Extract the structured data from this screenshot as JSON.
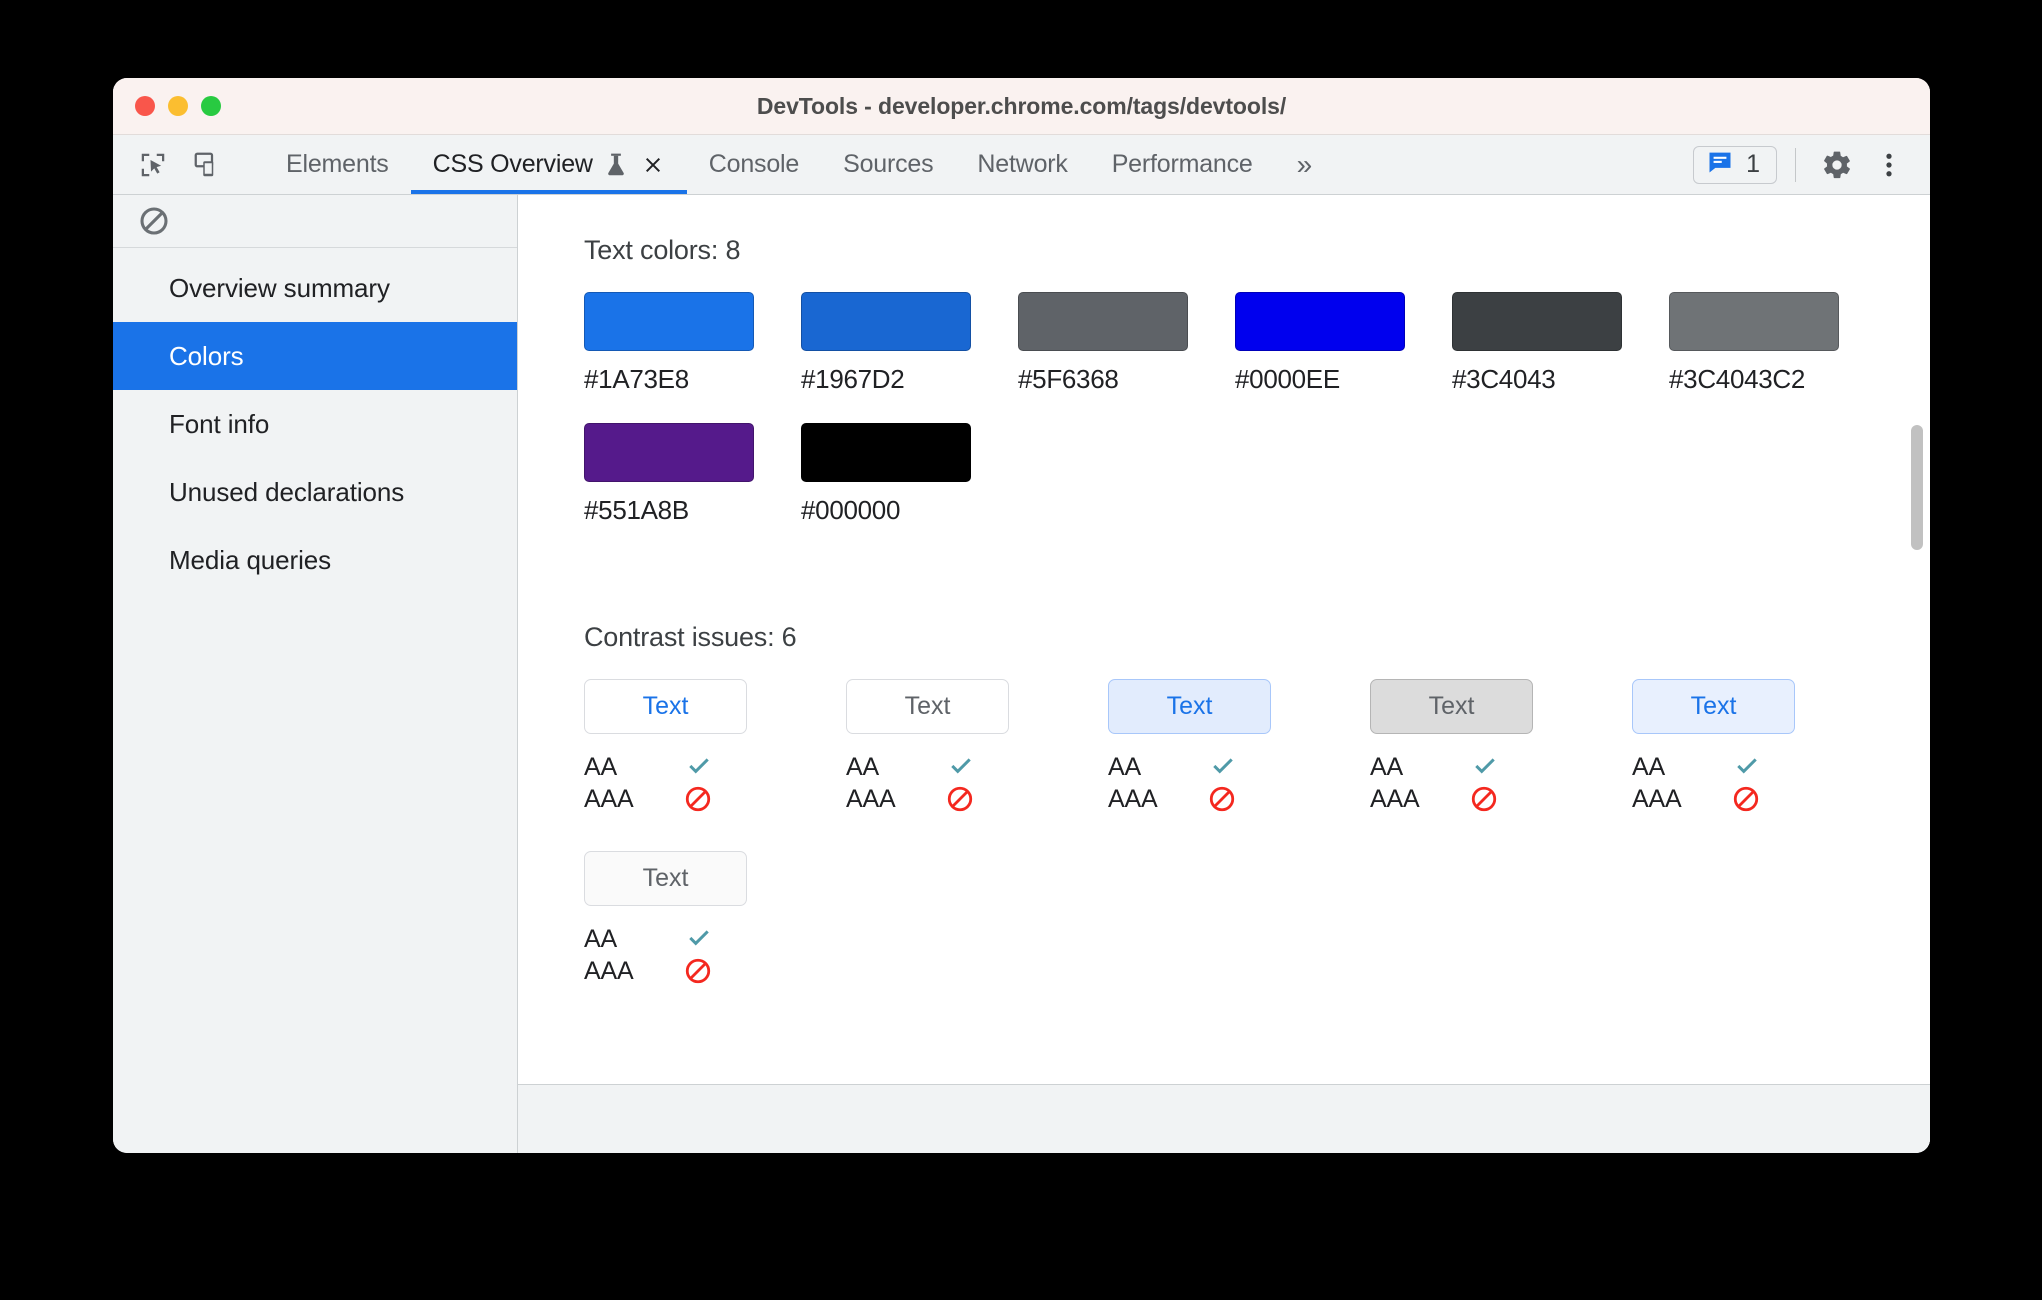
{
  "window": {
    "title": "DevTools - developer.chrome.com/tags/devtools/",
    "traffic_lights": [
      "close-red",
      "minimize-yellow",
      "zoom-green"
    ]
  },
  "toolbar": {
    "inspect_icon": "inspect-cursor-icon",
    "device_icon": "device-toolbar-icon",
    "more_tabs_label": "»",
    "issues": {
      "icon": "issues-message-icon",
      "count": "1"
    },
    "settings_icon": "gear-icon",
    "menu_icon": "vertical-dots-icon"
  },
  "tabs": [
    {
      "label": "Elements",
      "active": false
    },
    {
      "label": "CSS Overview",
      "active": true,
      "experiment_icon": "flask-icon",
      "close_icon": "close-icon"
    },
    {
      "label": "Console",
      "active": false
    },
    {
      "label": "Sources",
      "active": false
    },
    {
      "label": "Network",
      "active": false
    },
    {
      "label": "Performance",
      "active": false
    }
  ],
  "sidebar": {
    "toolbar_icon": "clear-block-icon",
    "items": [
      {
        "label": "Overview summary",
        "selected": false
      },
      {
        "label": "Colors",
        "selected": true
      },
      {
        "label": "Font info",
        "selected": false
      },
      {
        "label": "Unused declarations",
        "selected": false
      },
      {
        "label": "Media queries",
        "selected": false
      }
    ]
  },
  "main": {
    "text_colors_title": "Text colors: 8",
    "text_colors": [
      {
        "hex": "#1A73E8",
        "swatch": "#1a73e8"
      },
      {
        "hex": "#1967D2",
        "swatch": "#1967d2"
      },
      {
        "hex": "#5F6368",
        "swatch": "#5f6368"
      },
      {
        "hex": "#0000EE",
        "swatch": "#0000ee"
      },
      {
        "hex": "#3C4043",
        "swatch": "#3c4043"
      },
      {
        "hex": "#3C4043C2",
        "swatch": "#6f7376"
      },
      {
        "hex": "#551A8B",
        "swatch": "#551a8b"
      },
      {
        "hex": "#000000",
        "swatch": "#000000"
      }
    ],
    "contrast_title": "Contrast issues: 6",
    "contrast_aa_label": "AA",
    "contrast_aaa_label": "AAA",
    "contrast_pass_icon": "checkmark-icon",
    "contrast_fail_icon": "blocked-icon",
    "contrast_issues": [
      {
        "text": "Text",
        "fg": "#1a73e8",
        "bg": "#ffffff",
        "border": "#dadce0",
        "aa": "pass",
        "aaa": "fail"
      },
      {
        "text": "Text",
        "fg": "#5f6368",
        "bg": "#ffffff",
        "border": "#dadce0",
        "aa": "pass",
        "aaa": "fail"
      },
      {
        "text": "Text",
        "fg": "#1a73e8",
        "bg": "#e2ecfd",
        "border": "#a8c7fa",
        "aa": "pass",
        "aaa": "fail"
      },
      {
        "text": "Text",
        "fg": "#5f6368",
        "bg": "#dcdcdc",
        "border": "#b5b5b5",
        "aa": "pass",
        "aaa": "fail"
      },
      {
        "text": "Text",
        "fg": "#1a73e8",
        "bg": "#e8f0fe",
        "border": "#a8c7fa",
        "aa": "pass",
        "aaa": "fail"
      },
      {
        "text": "Text",
        "fg": "#5f6368",
        "bg": "#fafafa",
        "border": "#dadce0",
        "aa": "pass",
        "aaa": "fail"
      }
    ]
  },
  "colors": {
    "accent": "#1a73e8",
    "pass": "#4f9aa8",
    "fail": "#f4281f"
  }
}
